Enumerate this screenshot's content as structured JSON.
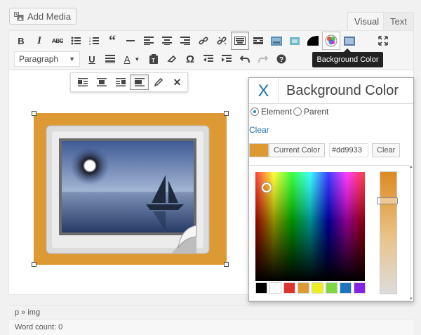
{
  "header": {
    "add_media_label": "Add Media",
    "tabs": [
      {
        "label": "Visual"
      },
      {
        "label": "Text"
      }
    ]
  },
  "toolbar": {
    "row1": [
      "bold-icon",
      "italic-icon",
      "strikethrough-icon",
      "bullet-list-icon",
      "numbered-list-icon",
      "blockquote-icon",
      "horizontal-line-icon",
      "align-left-icon",
      "align-center-icon",
      "align-right-icon",
      "insert-link-icon",
      "remove-link-icon",
      "keyboard-icon",
      "read-more-icon",
      "image-icon",
      "image-small-icon",
      "black-shape-icon",
      "background-color-icon",
      "image-tool-icon",
      "fullscreen-icon"
    ],
    "format_select": "Paragraph",
    "row2": [
      "underline-icon",
      "justify-icon",
      "text-color-icon",
      "paste-as-text-icon",
      "clear-formatting-icon",
      "special-character-icon",
      "outdent-icon",
      "indent-icon",
      "undo-icon",
      "redo-icon",
      "help-icon"
    ]
  },
  "tooltip": {
    "text": "Background Color"
  },
  "inline_toolbar": [
    "align-left-icon",
    "align-center-icon",
    "align-right-icon",
    "no-align-icon",
    "edit-icon",
    "remove-icon"
  ],
  "content": {
    "image_background": "#dd9933"
  },
  "status": {
    "path": "p » img",
    "word_count": "Word count: 0"
  },
  "popup": {
    "close_label": "X",
    "title": "Background Color",
    "target_options": [
      {
        "label": "Element",
        "checked": true
      },
      {
        "label": "Parent",
        "checked": false
      }
    ],
    "clear_link": "Clear",
    "current_color_label": "Current Color",
    "hex_value": "#dd9933",
    "clear_button": "Clear",
    "palette": [
      "#000000",
      "#ffffff",
      "#dd3333",
      "#dd9933",
      "#eeee22",
      "#81d742",
      "#1e73be",
      "#8224e3"
    ]
  }
}
